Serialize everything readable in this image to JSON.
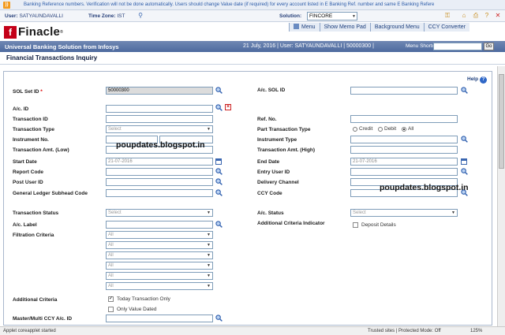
{
  "ticker": {
    "message": "Banking Reference numbers. Verification will not be done automatically. Users should change Value date (if required) for every account listed in E Banking Ref. number and same E Banking Refere"
  },
  "userbar": {
    "user_label": "User:",
    "user_value": "SATYAUNDAVALLI",
    "tz_label": "Time Zone:",
    "tz_value": "IST",
    "solution_label": "Solution:",
    "solution_value": "FINCORE"
  },
  "brand": {
    "logo_text": "Finacle",
    "logo_mark": "f",
    "tagline": "Universal Banking Solution from Infosys"
  },
  "nav": {
    "items": [
      "Menu",
      "Show Memo Pad",
      "Background Menu",
      "CCY Converter"
    ]
  },
  "subbar": {
    "date_user": "21 July, 2016 | User: SATYAUNDAVALLI | 50000300 |",
    "shortcut_label": "Menu Shortcut:",
    "go_label": "Go"
  },
  "page": {
    "title": "Financial Transactions Inquiry",
    "help_label": "Help",
    "help_glyph": "?"
  },
  "form": {
    "sol_set_id": {
      "label": "SOL Set ID",
      "required": "*",
      "value": "50000300"
    },
    "ac_sol_id": {
      "label": "A/c. SOL ID"
    },
    "ac_id": {
      "label": "A/c. ID"
    },
    "transaction_id": {
      "label": "Transaction ID"
    },
    "ref_no": {
      "label": "Ref. No."
    },
    "transaction_type": {
      "label": "Transaction Type",
      "value": "Select"
    },
    "part_transaction_type": {
      "label": "Part Transaction Type",
      "options": [
        "Credit",
        "Debit",
        "All"
      ],
      "selected": "All"
    },
    "instrument_no": {
      "label": "Instrument No."
    },
    "instrument_type": {
      "label": "Instrument Type"
    },
    "amt_low": {
      "label": "Transaction Amt. (Low)"
    },
    "amt_high": {
      "label": "Transaction Amt. (High)"
    },
    "start_date": {
      "label": "Start Date",
      "value": "21-07-2016"
    },
    "end_date": {
      "label": "End Date",
      "value": "21-07-2016"
    },
    "report_code": {
      "label": "Report Code"
    },
    "entry_user_id": {
      "label": "Entry User ID"
    },
    "post_user_id": {
      "label": "Post User ID"
    },
    "delivery_channel": {
      "label": "Delivery Channel"
    },
    "gl_subhead": {
      "label": "General Ledger Subhead Code"
    },
    "ccy_code": {
      "label": "CCY Code"
    },
    "transaction_status": {
      "label": "Transaction Status",
      "value": "Select"
    },
    "ac_status": {
      "label": "A/c. Status",
      "value": "Select"
    },
    "ac_label": {
      "label": "A/c. Label"
    },
    "additional_criteria_indicator": {
      "label": "Additional Criteria Indicator"
    },
    "deposit_details": {
      "label": "Deposit Details",
      "checked": false
    },
    "filtration_criteria": {
      "label": "Filtration Criteria",
      "values": [
        "All",
        "All",
        "All",
        "All",
        "All",
        "All",
        "All"
      ]
    },
    "additional_criteria": {
      "label": "Additional Criteria"
    },
    "today_transaction_only": {
      "label": "Today Transaction Only",
      "checked": true
    },
    "only_value_dated": {
      "label": "Only Value Dated",
      "checked": false
    },
    "master_ccy": {
      "label": "Master/Multi CCY A/c. ID"
    }
  },
  "watermarks": [
    "poupdates.blogspot.in",
    "poupdates.blogspot.in"
  ],
  "status": {
    "left": "Applet coreapplet started",
    "security": "Trusted sites | Protected Mode: Off",
    "zoom": "125%"
  },
  "colors": {
    "accent": "#4d6a9f",
    "brand_red": "#c40018",
    "link": "#2a5aa8"
  }
}
